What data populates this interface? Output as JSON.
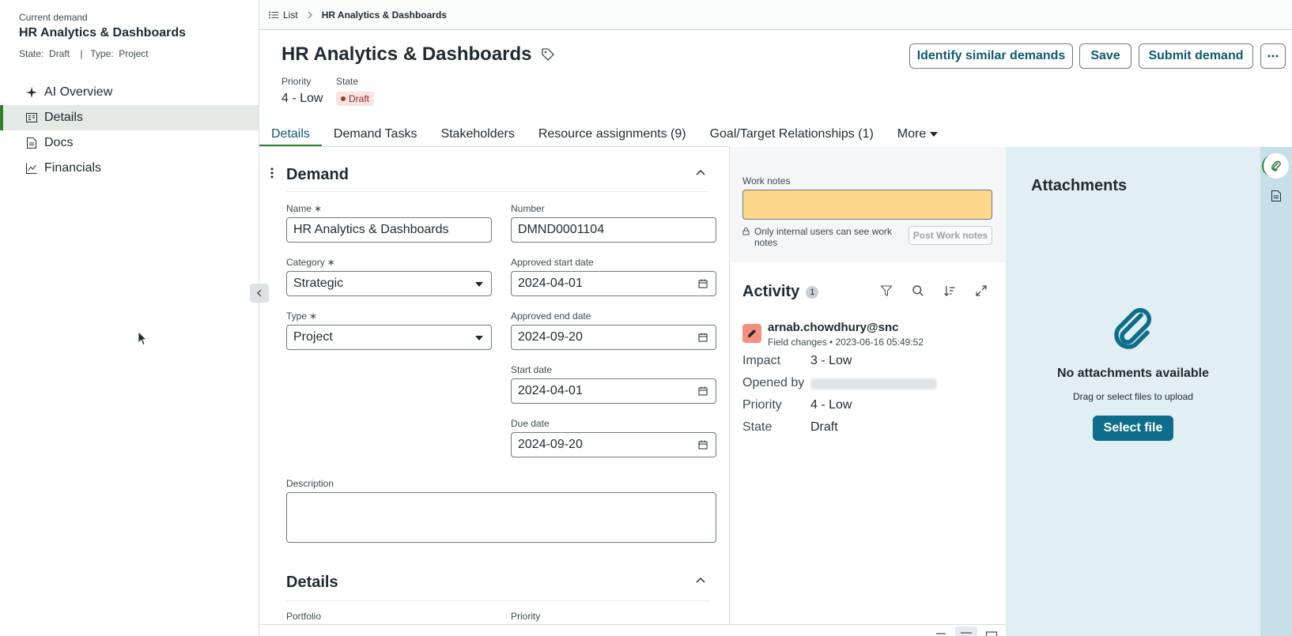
{
  "sidebar": {
    "caption": "Current demand",
    "title": "HR Analytics & Dashboards",
    "meta": "State:  Draft    |   Type:  Project",
    "items": [
      {
        "label": "AI Overview",
        "icon": "sparkle-icon"
      },
      {
        "label": "Details",
        "icon": "details-icon",
        "active": true
      },
      {
        "label": "Docs",
        "icon": "document-icon"
      },
      {
        "label": "Financials",
        "icon": "chart-line-icon"
      }
    ]
  },
  "breadcrumb": {
    "list": "List",
    "current": "HR Analytics & Dashboards"
  },
  "header": {
    "title": "HR Analytics & Dashboards",
    "priority_label": "Priority",
    "priority_value": "4 - Low",
    "state_label": "State",
    "state_value": "Draft"
  },
  "actions": {
    "identify": "Identify similar demands",
    "save": "Save",
    "submit": "Submit demand",
    "more": "···"
  },
  "tabs": [
    {
      "label": "Details",
      "active": true
    },
    {
      "label": "Demand Tasks"
    },
    {
      "label": "Stakeholders"
    },
    {
      "label": "Resource assignments (9)"
    },
    {
      "label": "Goal/Target Relationships (1)"
    },
    {
      "label": "More"
    }
  ],
  "form": {
    "section_demand": "Demand",
    "section_details": "Details",
    "name_label": "Name",
    "name_value": "HR Analytics & Dashboards",
    "number_label": "Number",
    "number_value": "DMND0001104",
    "category_label": "Category",
    "category_value": "Strategic",
    "approved_start_label": "Approved start date",
    "approved_start_value": "2024-04-01",
    "type_label": "Type",
    "type_value": "Project",
    "approved_end_label": "Approved end date",
    "approved_end_value": "2024-09-20",
    "start_label": "Start date",
    "start_value": "2024-04-01",
    "due_label": "Due date",
    "due_value": "2024-09-20",
    "description_label": "Description",
    "portfolio_label": "Portfolio",
    "priority_label": "Priority",
    "required_mark": "∗"
  },
  "activity": {
    "work_notes_label": "Work notes",
    "work_notes_note": "Only internal users can see work notes",
    "post_button": "Post Work notes",
    "title": "Activity",
    "count": "1",
    "entry": {
      "user": "arnab.chowdhury@snc",
      "meta": "Field changes • 2023-06-16 05:49:52",
      "changes": [
        {
          "key": "Impact",
          "value": "3 - Low"
        },
        {
          "key": "Opened by",
          "value": ""
        },
        {
          "key": "Priority",
          "value": "4 - Low"
        },
        {
          "key": "State",
          "value": "Draft"
        }
      ]
    }
  },
  "attachments": {
    "title": "Attachments",
    "empty": "No attachments available",
    "hint": "Drag or select files to upload",
    "select_button": "Select file"
  },
  "colors": {
    "accent": "#0d5a73",
    "active_green": "#2e7d32",
    "work_notes_bg": "#fdd78c",
    "attachments_bg": "#e1eef3",
    "primary_button": "#0d6e8c"
  }
}
